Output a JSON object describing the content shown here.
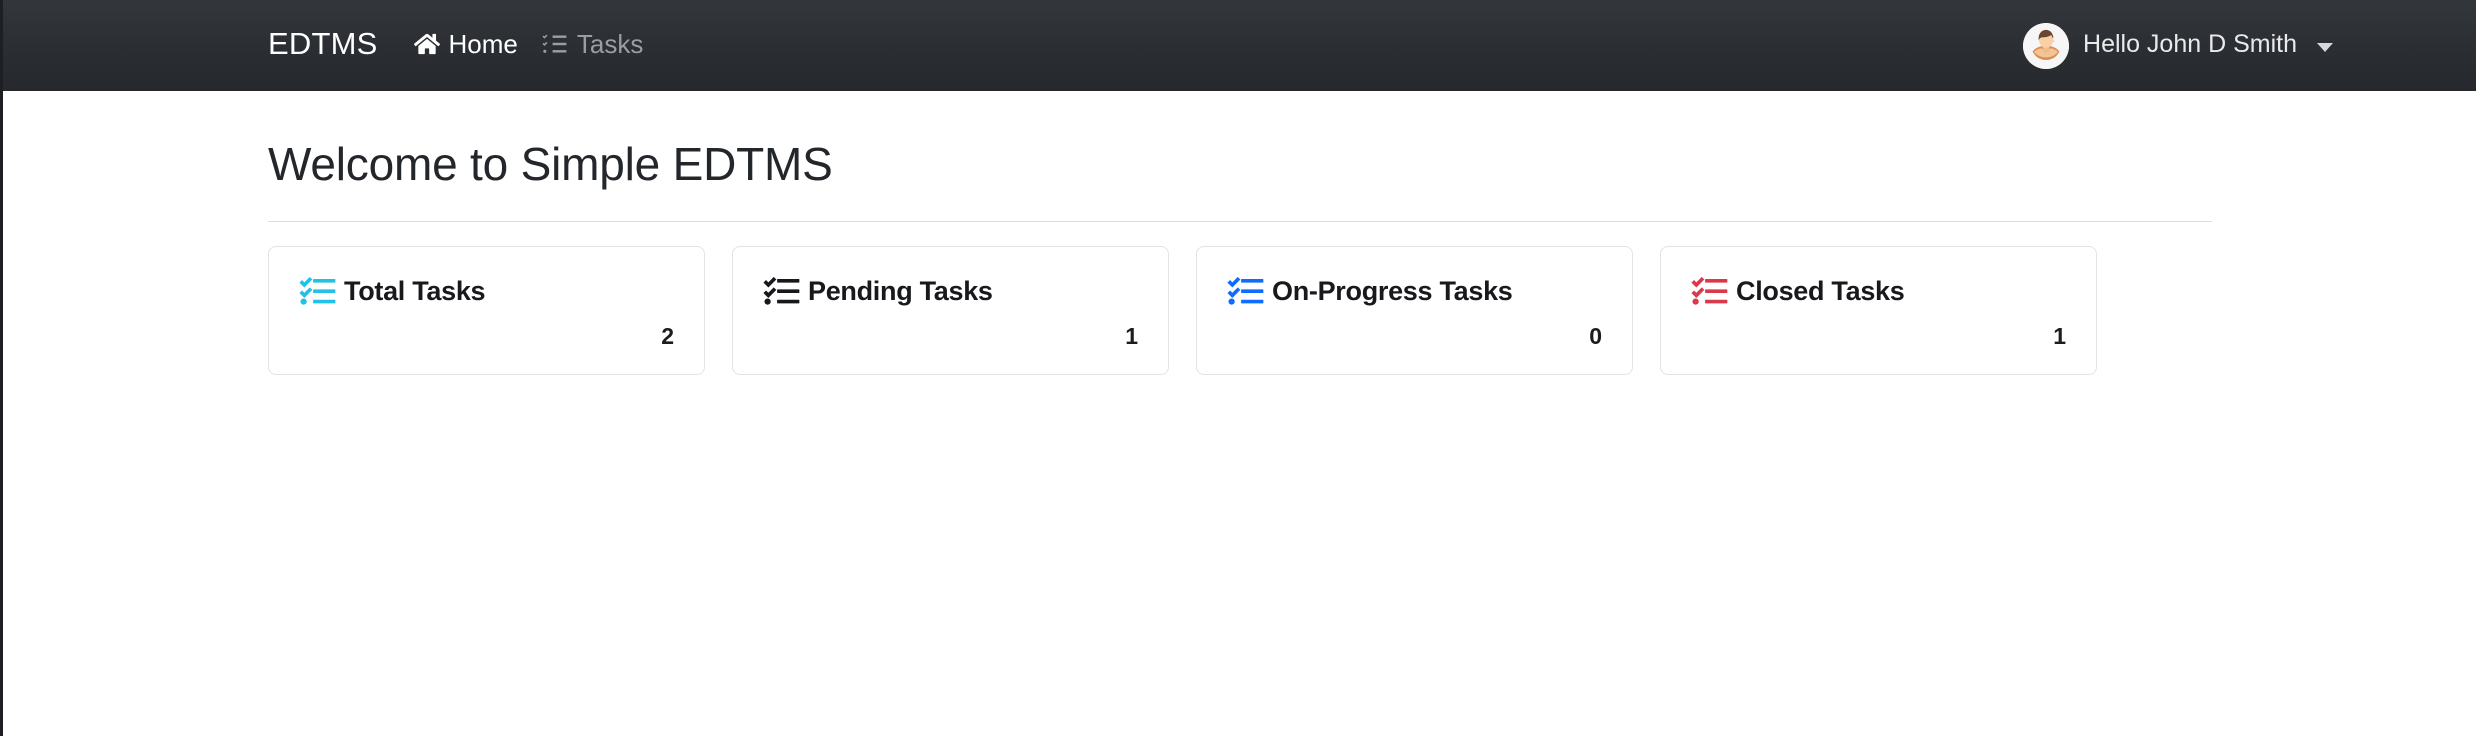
{
  "navbar": {
    "brand": "EDTMS",
    "links": [
      {
        "label": "Home",
        "icon": "home-icon",
        "state": "active"
      },
      {
        "label": "Tasks",
        "icon": "list-check-icon",
        "state": "muted"
      }
    ],
    "user": {
      "greeting": "Hello John D Smith",
      "avatar_icon": "user-avatar",
      "caret_icon": "caret-down-icon"
    },
    "background_color": "#2c2f34"
  },
  "main": {
    "page_title": "Welcome to Simple EDTMS",
    "cards": [
      {
        "label": "Total Tasks",
        "value": "2",
        "icon": "list-check-icon",
        "color": "#22c1e8"
      },
      {
        "label": "Pending Tasks",
        "value": "1",
        "icon": "list-check-icon",
        "color": "#16181c"
      },
      {
        "label": "On-Progress Tasks",
        "value": "0",
        "icon": "list-check-icon",
        "color": "#0d6efd"
      },
      {
        "label": "Closed Tasks",
        "value": "1",
        "icon": "list-check-icon",
        "color": "#d9394b"
      }
    ]
  }
}
